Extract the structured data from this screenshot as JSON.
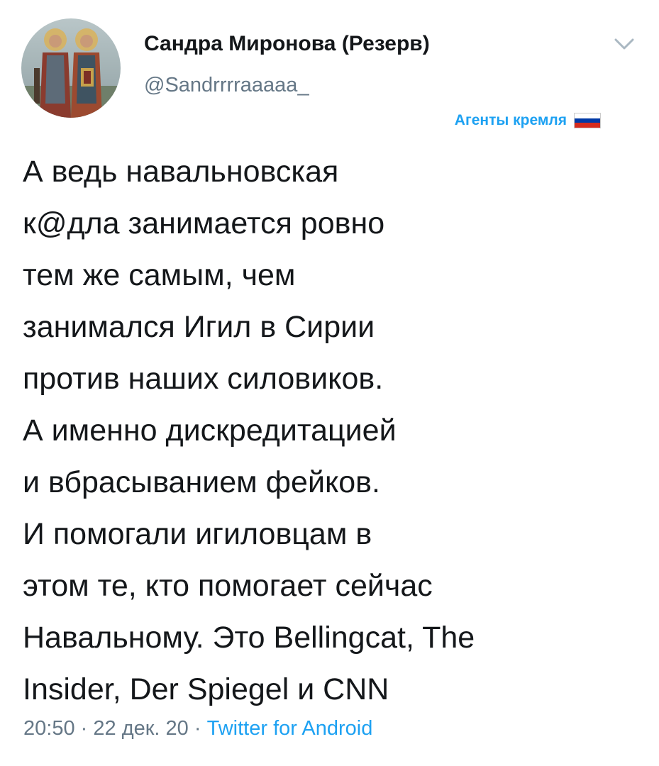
{
  "author": {
    "display_name": "Сандра Миронова (Резерв)",
    "handle": "@Sandrrrraaaaa_",
    "avatar_icon": "icon-saints-avatar"
  },
  "menu_icon": "chevron-down-icon",
  "bio_badge": {
    "text": "Агенты кремля",
    "flag_icon": "russian-flag-icon",
    "flag_colors": [
      "#ffffff",
      "#0039a6",
      "#d52b1e"
    ]
  },
  "tweet": {
    "lines": [
      "А ведь навальновская",
      "к@дла занимается ровно",
      "тем же самым, чем",
      "занимался Игил в Сирии",
      "против наших силовиков.",
      "А именно дискредитацией",
      "и вбрасыванием фейков.",
      "И помогали игиловцам в",
      "этом те, кто помогает сейчас",
      "Навальному. Это Bellingcat, The",
      "Insider, Der Spiegel и CNN"
    ]
  },
  "meta": {
    "time": "20:50",
    "separator": "·",
    "date": "22 дек. 20",
    "source": "Twitter for Android"
  },
  "colors": {
    "text": "#14171a",
    "secondary": "#657786",
    "accent": "#1da1f2"
  }
}
